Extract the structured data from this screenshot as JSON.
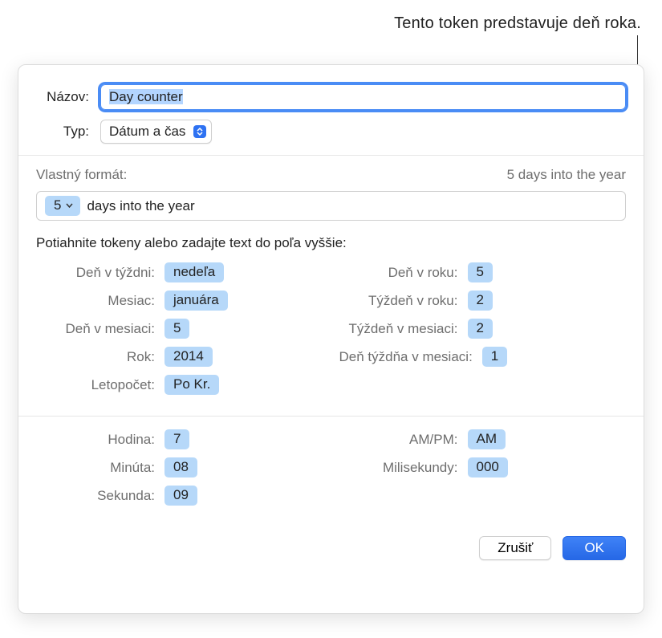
{
  "callout": "Tento token predstavuje deň roka.",
  "labels": {
    "name": "Názov:",
    "type": "Typ:",
    "custom_format": "Vlastný formát:",
    "drag_hint": "Potiahnite tokeny alebo zadajte text do poľa vyššie:"
  },
  "name_value": "Day counter",
  "type_value": "Dátum a čas",
  "preview": "5 days into the year",
  "format_token_value": "5",
  "format_suffix_text": "days into the year",
  "tokens_left": [
    {
      "label": "Deň v týždni:",
      "value": "nedeľa"
    },
    {
      "label": "Mesiac:",
      "value": "januára"
    },
    {
      "label": "Deň v mesiaci:",
      "value": "5"
    },
    {
      "label": "Rok:",
      "value": "2014"
    },
    {
      "label": "Letopočet:",
      "value": "Po Kr."
    }
  ],
  "tokens_right": [
    {
      "label": "Deň v roku:",
      "value": "5"
    },
    {
      "label": "Týždeň v roku:",
      "value": "2"
    },
    {
      "label": "Týždeň v mesiaci:",
      "value": "2"
    },
    {
      "label": "Deň týždňa v mesiaci:",
      "value": "1"
    }
  ],
  "tokens_time_left": [
    {
      "label": "Hodina:",
      "value": "7"
    },
    {
      "label": "Minúta:",
      "value": "08"
    },
    {
      "label": "Sekunda:",
      "value": "09"
    }
  ],
  "tokens_time_right": [
    {
      "label": "AM/PM:",
      "value": "AM"
    },
    {
      "label": "Milisekundy:",
      "value": "000"
    }
  ],
  "buttons": {
    "cancel": "Zrušiť",
    "ok": "OK"
  }
}
